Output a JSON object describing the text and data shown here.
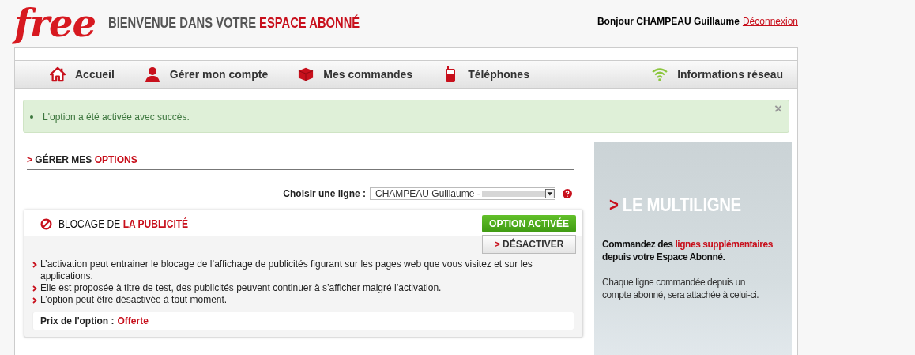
{
  "header": {
    "logo": "free",
    "welcome": {
      "plain": "BIENVENUE DANS VOTRE",
      "accent": "ESPACE ABONNÉ"
    },
    "greeting": "Bonjour CHAMPEAU Guillaume",
    "logout": "Déconnexion"
  },
  "nav": {
    "items": [
      {
        "label": "Accueil"
      },
      {
        "label": "Gérer mon compte"
      },
      {
        "label": "Mes commandes"
      },
      {
        "label": "Téléphones"
      }
    ],
    "right": {
      "label": "Informations réseau"
    }
  },
  "alert": {
    "message": "L'option a été activée avec succès.",
    "close": "×"
  },
  "section": {
    "arrow": ">",
    "plain": "GÉRER MES",
    "accent": "OPTIONS"
  },
  "line_select": {
    "label": "Choisir une ligne :",
    "value": "CHAMPEAU Guillaume -"
  },
  "option": {
    "title_plain": "BLOCAGE DE",
    "title_accent": "LA PUBLICITÉ",
    "status": "OPTION ACTIVÉE",
    "active": true,
    "deactivate_arrow": ">",
    "deactivate": "DÉSACTIVER",
    "bullets": [
      "L’activation peut entrainer le blocage de l’affichage de publicités figurant sur les pages web que vous visitez et sur les applications.",
      "Elle est proposée à titre de test, des publicités peuvent continuer à s’afficher malgré l’activation.",
      "L’option peut être désactivée à tout moment."
    ],
    "price_label": "Prix de l'option :",
    "price": "Offerte"
  },
  "promo": {
    "arrow": ">",
    "title": "LE MULTILIGNE",
    "lead_plain": "Commandez des",
    "lead_accent": "lignes supplémentaires",
    "lead_end": "depuis votre Espace Abonné.",
    "body": "Chaque ligne commandée depuis un compte abonné, sera attachée à celui-ci."
  }
}
